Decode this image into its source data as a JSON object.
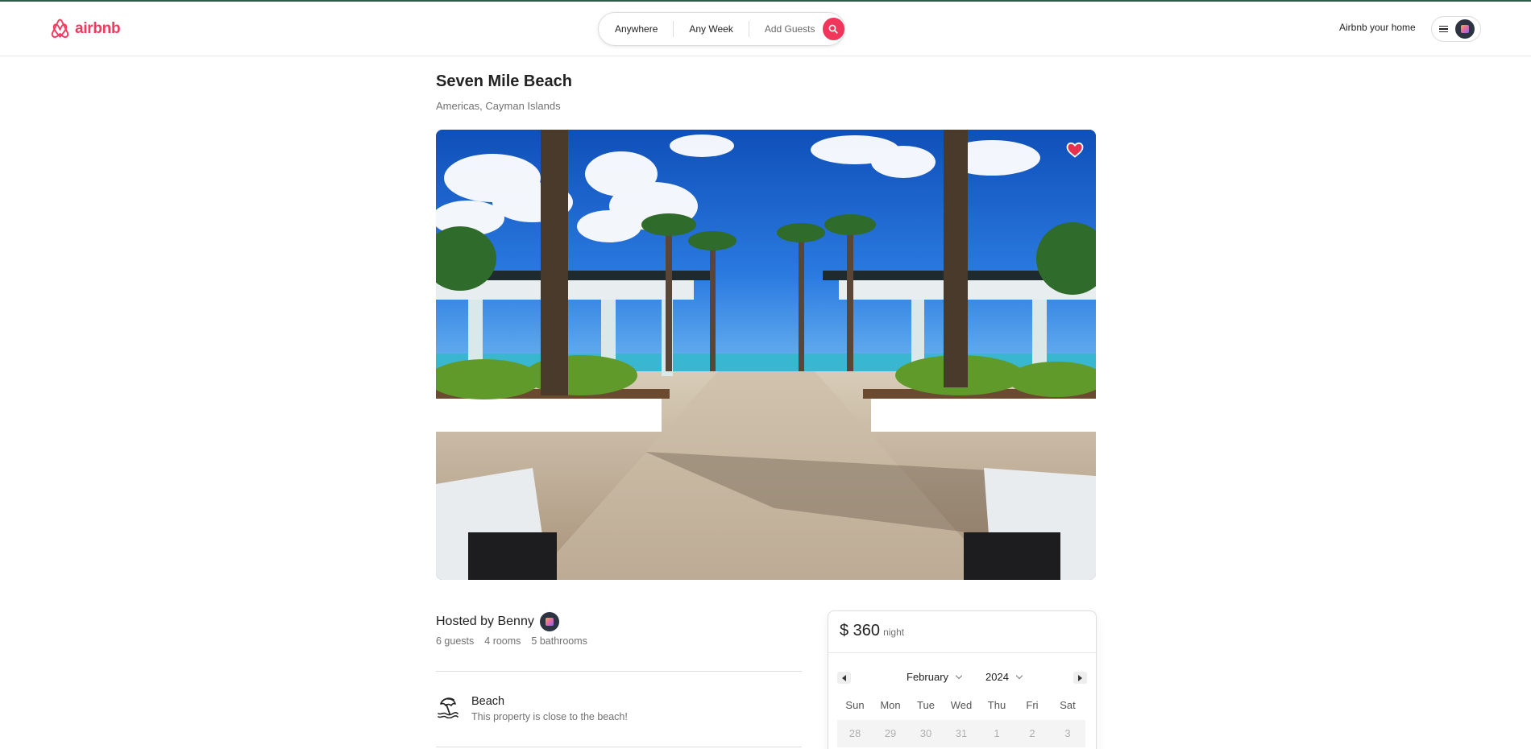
{
  "header": {
    "logo_text": "airbnb",
    "search": {
      "location": "Anywhere",
      "week": "Any Week",
      "guests": "Add Guests"
    },
    "host_link": "Airbnb your home"
  },
  "listing": {
    "title": "Seven Mile Beach",
    "location": "Americas, Cayman Islands",
    "hosted_by": "Hosted by Benny",
    "stats": [
      "6 guests",
      "4 rooms",
      "5 bathrooms"
    ],
    "feature": {
      "icon": "beach-umbrella-icon",
      "title": "Beach",
      "description": "This property is close to the beach!"
    }
  },
  "booking": {
    "price": "$ 360",
    "unit": "night",
    "calendar": {
      "month": "February",
      "year": "2024",
      "weekdays": [
        "Sun",
        "Mon",
        "Tue",
        "Wed",
        "Thu",
        "Fri",
        "Sat"
      ],
      "first_row": [
        "28",
        "29",
        "30",
        "31",
        "1",
        "2",
        "3"
      ]
    }
  },
  "colors": {
    "brand": "#f5385d",
    "favorite": "#e8304f"
  }
}
